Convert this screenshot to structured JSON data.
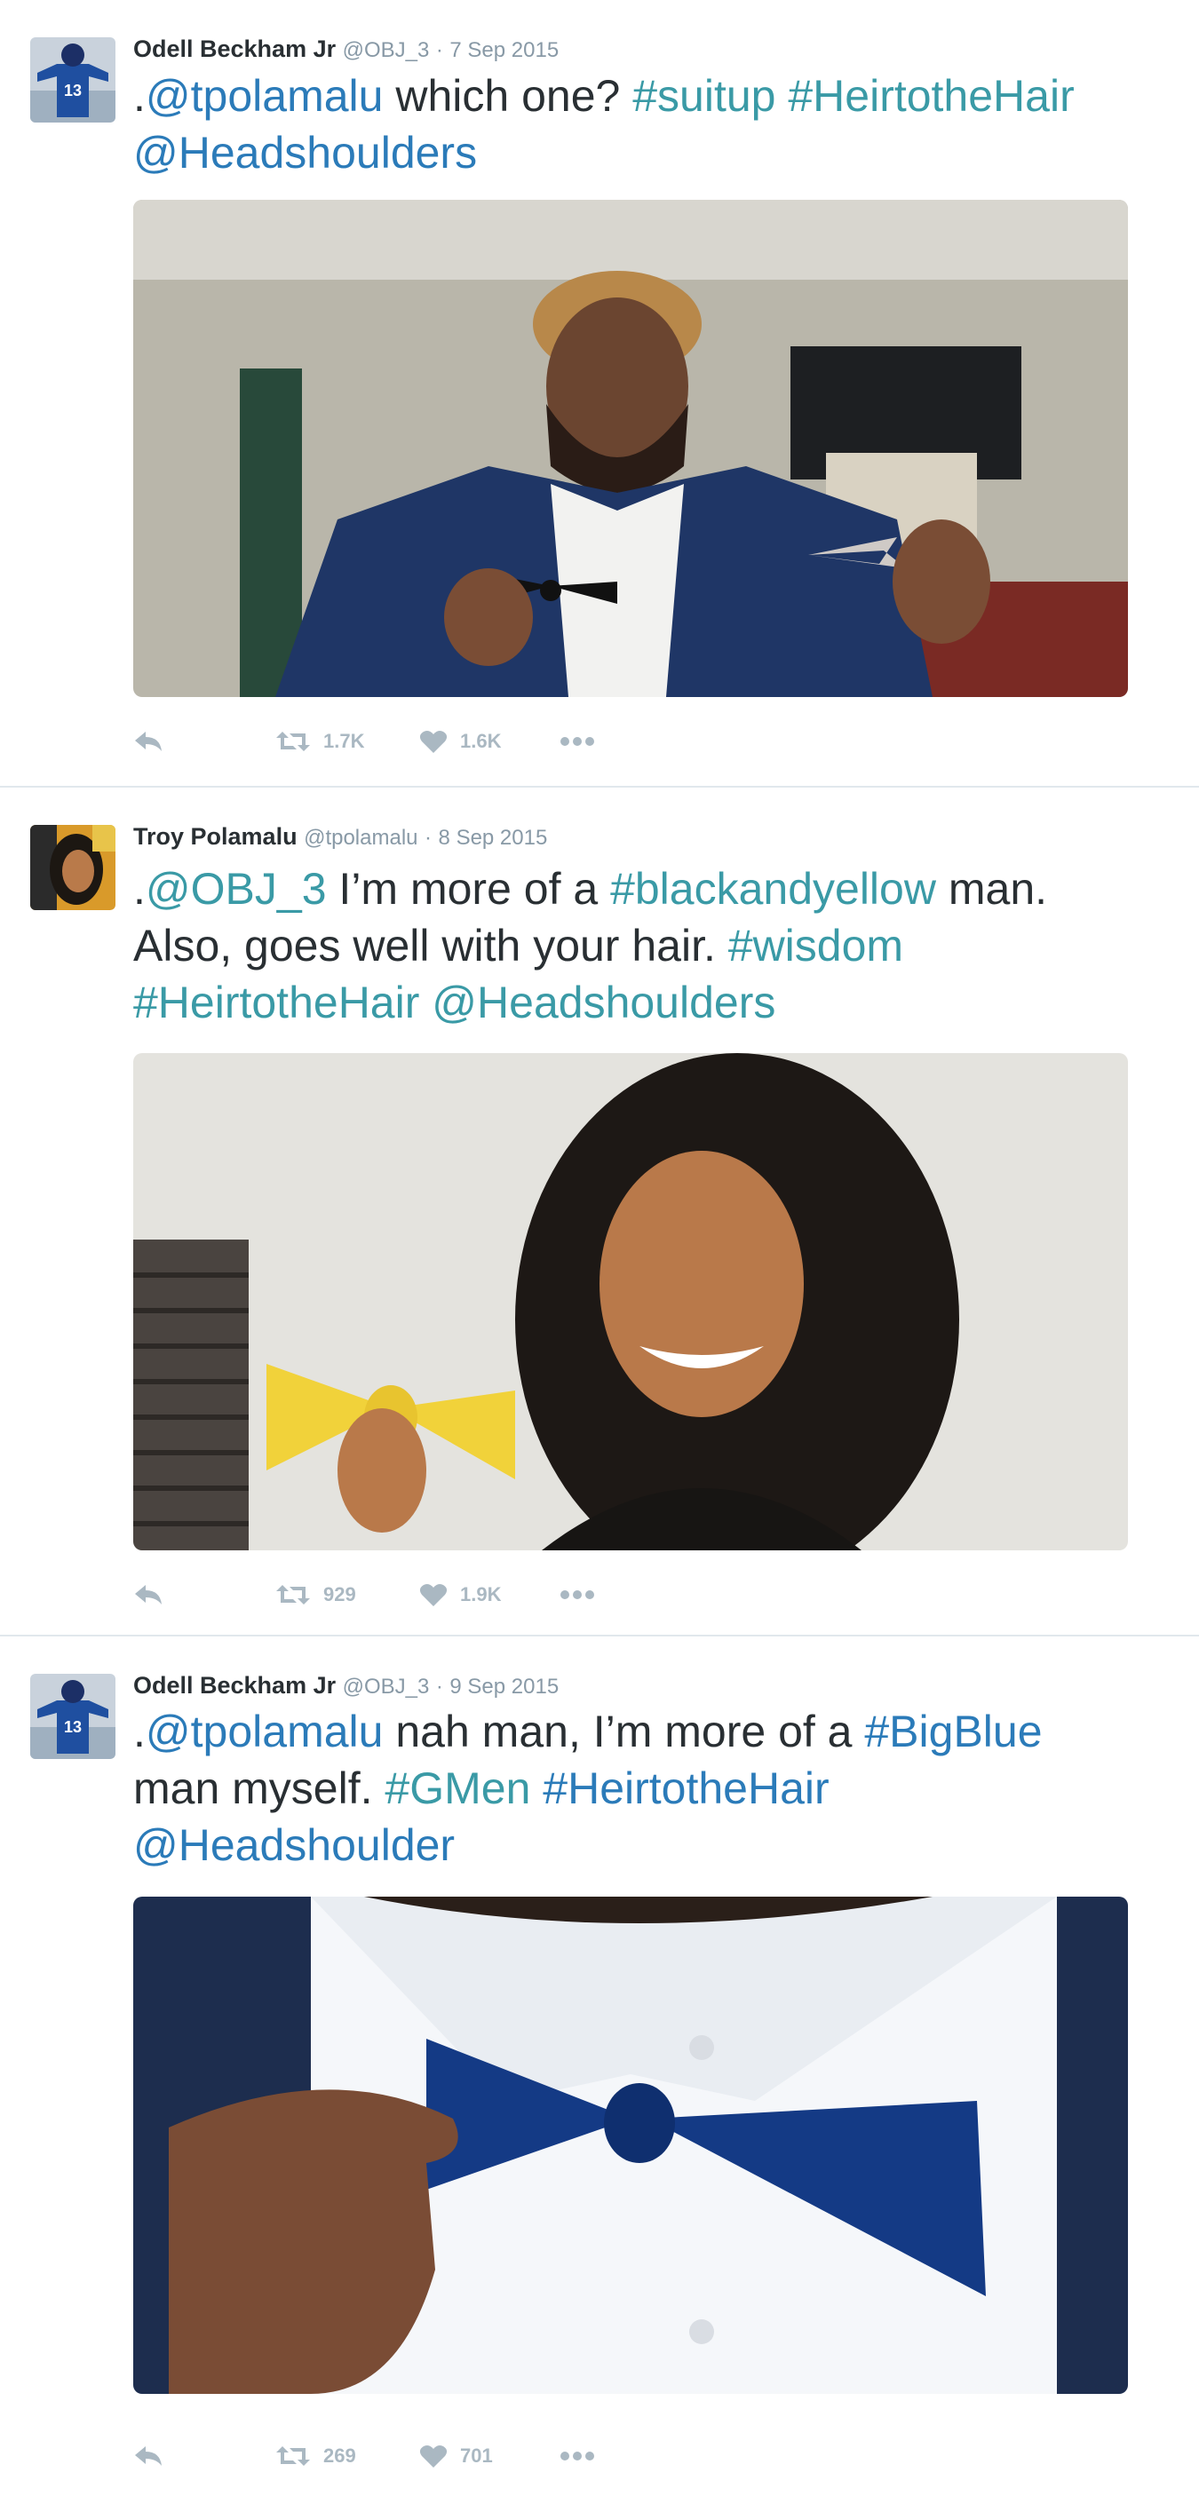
{
  "tweets": [
    {
      "author": "Odell Beckham Jr",
      "handle": "@OBJ_3",
      "separator": "·",
      "date": "7 Sep 2015",
      "text_parts": [
        {
          "t": ".",
          "type": "plain"
        },
        {
          "t": "@tpolamalu",
          "type": "mention"
        },
        {
          "t": " which one? ",
          "type": "plain"
        },
        {
          "t": "#suitup",
          "type": "hashtag"
        },
        {
          "t": " ",
          "type": "plain"
        },
        {
          "t": "#HeirtotheHair",
          "type": "hashtag"
        },
        {
          "t": " ",
          "type": "plain"
        },
        {
          "t": "@Headshoulders",
          "type": "mention"
        }
      ],
      "retweets": "1.7K",
      "likes": "1.6K",
      "media_icon": "photo-man-holding-two-bowties",
      "avatar_icon": "giants-player-avatar"
    },
    {
      "author": "Troy Polamalu",
      "handle": "@tpolamalu",
      "separator": "·",
      "date": "8 Sep 2015",
      "text_parts": [
        {
          "t": ".",
          "type": "plain"
        },
        {
          "t": "@OBJ_3",
          "type": "mention"
        },
        {
          "t": " I’m more of a ",
          "type": "plain"
        },
        {
          "t": "#blackandyellow",
          "type": "hashtag"
        },
        {
          "t": " man. Also, goes well with your hair. ",
          "type": "plain"
        },
        {
          "t": "#wisdom",
          "type": "hashtag"
        },
        {
          "t": " ",
          "type": "plain"
        },
        {
          "t": "#HeirtotheHair",
          "type": "hashtag"
        },
        {
          "t": " ",
          "type": "plain"
        },
        {
          "t": "@Headshoulders",
          "type": "mention"
        }
      ],
      "retweets": "929",
      "likes": "1.9K",
      "media_icon": "photo-man-holding-yellow-bowtie",
      "avatar_icon": "painted-portrait-avatar"
    },
    {
      "author": "Odell Beckham Jr",
      "handle": "@OBJ_3",
      "separator": "·",
      "date": "9 Sep 2015",
      "text_parts": [
        {
          "t": ".",
          "type": "plain"
        },
        {
          "t": "@tpolamalu",
          "type": "mention"
        },
        {
          "t": " nah man, I’m more of a ",
          "type": "plain"
        },
        {
          "t": "#BigBlue",
          "type": "hashtag"
        },
        {
          "t": " man myself. ",
          "type": "plain"
        },
        {
          "t": "#GMen",
          "type": "hashtag"
        },
        {
          "t": " ",
          "type": "plain"
        },
        {
          "t": "#HeirtotheHair",
          "type": "hashtag"
        },
        {
          "t": " ",
          "type": "plain"
        },
        {
          "t": "@Headshoulder",
          "type": "mention"
        }
      ],
      "retweets": "269",
      "likes": "701",
      "media_icon": "photo-blue-bowtie-closeup",
      "avatar_icon": "giants-player-avatar"
    }
  ],
  "colors": {
    "link_blue": "#2b7bb9",
    "link_teal": "#3a9aa6",
    "meta_gray": "#8899a6",
    "action_gray": "#aab8c2",
    "divider": "#e1e8ed"
  },
  "icons": {
    "reply": "reply-icon",
    "retweet": "retweet-icon",
    "like": "heart-icon",
    "more": "more-dots-icon"
  }
}
